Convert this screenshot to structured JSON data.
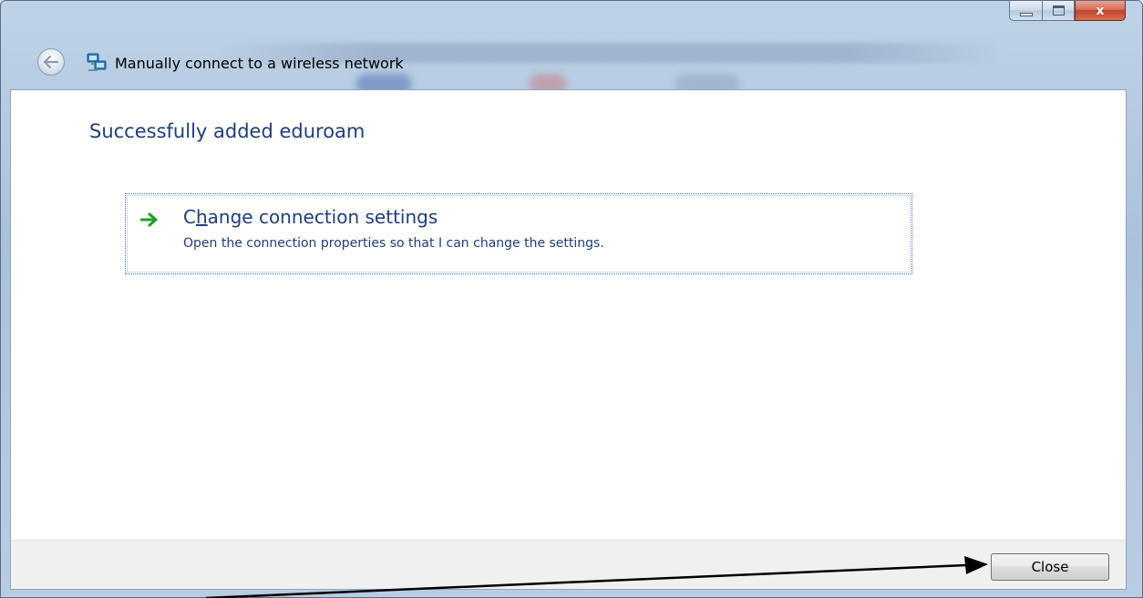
{
  "window": {
    "title": "Manually connect to a wireless network",
    "caption_buttons": {
      "minimize_icon": "minimize-icon",
      "maximize_icon": "maximize-icon",
      "close_glyph": "x"
    }
  },
  "header": {
    "back_icon": "back-arrow-icon",
    "network_icon": "network-icon"
  },
  "content": {
    "heading": "Successfully added eduroam",
    "command_link": {
      "icon": "green-arrow-icon",
      "title_pre": "C",
      "title_accel": "h",
      "title_post": "ange connection settings",
      "description": "Open the connection properties so that I can change the settings."
    }
  },
  "footer": {
    "close_label": "Close"
  },
  "colors": {
    "heading": "#1d3e82",
    "arrow": "#1aa321",
    "annotation": "#000000"
  }
}
